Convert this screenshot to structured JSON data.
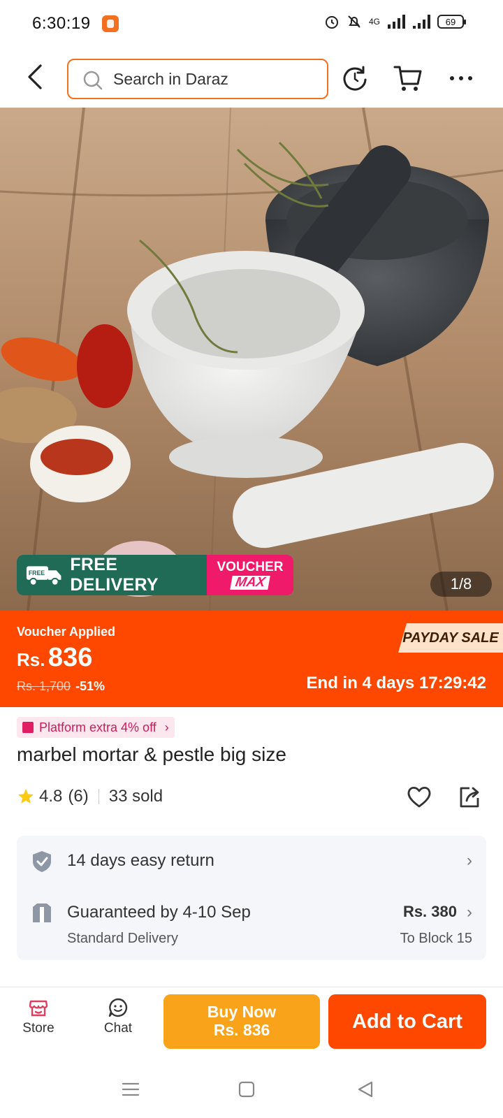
{
  "status_bar": {
    "time": "6:30:19",
    "network": "4G",
    "battery": "69"
  },
  "header": {
    "search_placeholder": "Search in Daraz"
  },
  "hero": {
    "free_delivery_label": "FREE DELIVERY",
    "free_tag": "FREE",
    "voucher_label": "VOUCHER",
    "voucher_max": "MAX",
    "image_counter": "1/8"
  },
  "price": {
    "voucher_applied": "Voucher Applied",
    "currency": "Rs.",
    "current": "836",
    "original": "Rs. 1,700",
    "discount": "-51%",
    "sale_badge": "PAYDAY SALE",
    "ends": "End in 4 days 17:29:42"
  },
  "product": {
    "platform_offer": "Platform extra 4% off",
    "title": "marbel mortar & pestle big size",
    "rating": "4.8",
    "review_count": "(6)",
    "sold": "33 sold"
  },
  "services": {
    "return_policy": "14 days easy return",
    "delivery_guarantee": "Guaranteed by 4-10 Sep",
    "delivery_type": "Standard Delivery",
    "delivery_fee": "Rs. 380",
    "destination": "To Block 15"
  },
  "bottom_bar": {
    "store_label": "Store",
    "chat_label": "Chat",
    "buy_now_label": "Buy Now",
    "buy_now_price": "Rs. 836",
    "add_to_cart_label": "Add to Cart"
  },
  "colors": {
    "brand_orange": "#fe4800",
    "buy_now_yellow": "#f9a31b",
    "free_delivery_green": "#1f6b56",
    "voucher_pink": "#ef1b6a"
  }
}
